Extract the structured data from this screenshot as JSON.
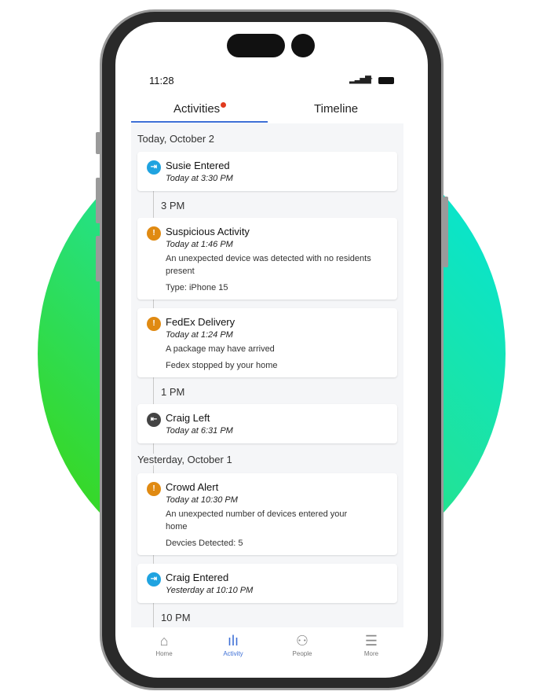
{
  "status": {
    "time": "11:28"
  },
  "tabs": [
    {
      "label": "Activities",
      "active": true,
      "badge": true
    },
    {
      "label": "Timeline"
    }
  ],
  "colors": {
    "accent": "#3d6fd6",
    "entered": "#1fa3e0",
    "alert": "#e08a12",
    "left": "#444444",
    "badge": "#e03a1e"
  },
  "feed": {
    "today": "Today, October 2",
    "yesterday": "Yesterday, October 1",
    "cards": [
      {
        "title": "Susie Entered",
        "time": "Today at 3:30 PM",
        "icon": "home-enter-icon"
      },
      {
        "title": "Suspicious Activity",
        "time": "Today at 1:46 PM",
        "desc": "An unexpected device was detected with no residents present",
        "extra": "Type: iPhone 15",
        "icon": "alert-icon"
      },
      {
        "title": "FedEx Delivery",
        "time": "Today at 1:24 PM",
        "desc": "A package may have arrived",
        "extra": "Fedex stopped by your home",
        "icon": "alert-icon"
      },
      {
        "title": "Craig Left",
        "time": "Today at 6:31 PM",
        "icon": "home-exit-icon"
      },
      {
        "title": "Crowd Alert",
        "time": "Today at 10:30 PM",
        "desc": "An unexpected number of devices entered your home",
        "extra": "Devcies Detected: 5",
        "icon": "alert-icon"
      },
      {
        "title": "Craig Entered",
        "time": "Yesterday at 10:10 PM",
        "icon": "home-enter-icon"
      }
    ],
    "hours": [
      "3 PM",
      "1 PM",
      "10 PM"
    ]
  },
  "nav": [
    {
      "label": "Home",
      "icon": "home-icon"
    },
    {
      "label": "Activity",
      "icon": "activity-icon",
      "active": true
    },
    {
      "label": "People",
      "icon": "people-icon"
    },
    {
      "label": "More",
      "icon": "menu-icon"
    }
  ]
}
